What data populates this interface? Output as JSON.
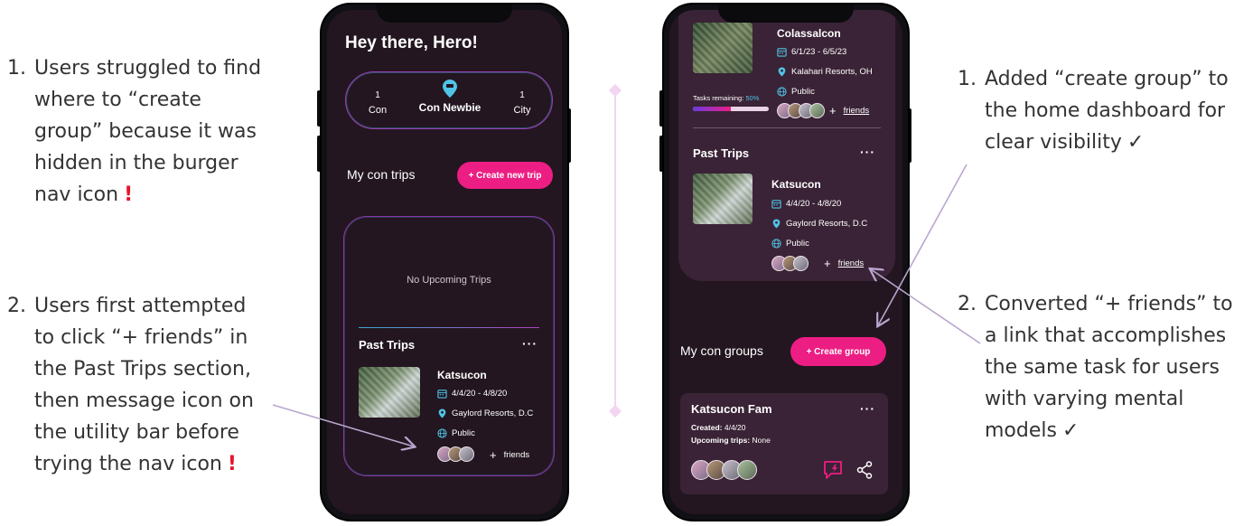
{
  "left_notes": [
    {
      "num": "1.",
      "lines": [
        "Users struggled to find",
        "where to “create",
        "group” because it was",
        "hidden in the burger",
        "nav icon"
      ],
      "mark": "!"
    },
    {
      "num": "2.",
      "lines": [
        "Users first attempted",
        "to click “+ friends” in",
        "the Past Trips section,",
        "then message icon on",
        "the utility bar before",
        "trying the nav icon"
      ],
      "mark": "!"
    }
  ],
  "right_notes": [
    {
      "num": "1.",
      "lines": [
        "Added “create group” to",
        "the home dashboard for",
        "clear visibility"
      ],
      "mark": "✓"
    },
    {
      "num": "2.",
      "lines": [
        "Converted “+ friends” to",
        "a link that accomplishes",
        "the same task for users",
        "with varying mental",
        "models"
      ],
      "mark": "✓"
    }
  ],
  "phone_left": {
    "greeting": "Hey there, Hero!",
    "stats": {
      "left_num": "1",
      "left_label": "Con",
      "badge_label": "Con Newbie",
      "right_num": "1",
      "right_label": "City"
    },
    "trips_heading": "My con trips",
    "create_trip_label": "+ Create new trip",
    "empty_text": "No Upcoming Trips",
    "past_title": "Past Trips",
    "more": "···",
    "trip": {
      "name": "Katsucon",
      "dates": "4/4/20 - 4/8/20",
      "location": "Gaylord Resorts, D.C",
      "visibility": "Public",
      "plus": "+",
      "friends": "friends"
    }
  },
  "phone_right": {
    "top_trip": {
      "name": "Colassalcon",
      "dates": "6/1/23 - 6/5/23",
      "location": "Kalahari Resorts, OH",
      "visibility": "Public",
      "plus": "+",
      "friends": "friends",
      "tasks_label": "Tasks remaining:",
      "tasks_pct": "50%",
      "progress": 0.5
    },
    "past_title": "Past Trips",
    "more": "···",
    "past_trip": {
      "name": "Katsucon",
      "dates": "4/4/20 - 4/8/20",
      "location": "Gaylord Resorts, D.C",
      "visibility": "Public",
      "plus": "+",
      "friends": "friends"
    },
    "groups_heading": "My con groups",
    "create_group_label": "+ Create group",
    "group": {
      "name": "Katsucon Fam",
      "more": "···",
      "created_label": "Created:",
      "created": "4/4/20",
      "upcoming_label": "Upcoming trips:",
      "upcoming": "None"
    }
  },
  "colors": {
    "accent_pink": "#ec1e83",
    "screen_bg": "#231620",
    "card_bg": "#3a2336",
    "cyan": "#4fc4e6",
    "warn": "#e5162c"
  },
  "icons": [
    "calendar-icon",
    "location-pin-icon",
    "globe-icon",
    "message-icon",
    "share-icon",
    "badge-pin-icon"
  ]
}
